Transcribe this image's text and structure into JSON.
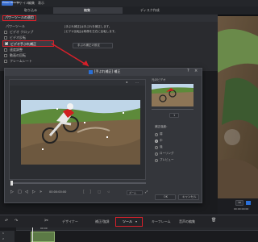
{
  "app": {
    "logo": "Power Director",
    "menu": [
      "ファイル",
      "編集",
      "表示",
      "再生",
      "ツール",
      "ヘルプ"
    ],
    "tabs": [
      {
        "label": "取り込み"
      },
      {
        "label": "編集"
      },
      {
        "label": "ディスク作成"
      }
    ],
    "active_tab": 1
  },
  "toolbar_row": {
    "left_label": "取り込み",
    "right_icons": [
      "grid-icon",
      "list-icon"
    ]
  },
  "tool_panel": {
    "title": "パワーツールの適用",
    "section_label": "パワーツール",
    "items": [
      {
        "label": "ビデオ クロップ",
        "checked": false
      },
      {
        "label": "ビデオ反転",
        "checked": false
      },
      {
        "label": "ビデオ手ぶれ補正",
        "checked": true
      },
      {
        "label": "速度調整",
        "checked": false
      },
      {
        "label": "動画の回転",
        "checked": false
      },
      {
        "label": "フレームレート",
        "checked": false
      }
    ],
    "description": [
      "[手ぶれ補正]は手ぶれを補正します。",
      "[ビデオ反転]は映像を左右に反転します。"
    ],
    "settings_button": "手ぶれ補正の設定"
  },
  "dialog": {
    "title": "[手ぶれ補正] 補正",
    "preview_label": "",
    "original_label": "元のビデオ",
    "strength_label": "補正強度：",
    "strength_value": "1",
    "options_label": "補正強度：",
    "options": [
      {
        "label": "弱",
        "selected": false
      },
      {
        "label": "中",
        "selected": true
      },
      {
        "label": "強",
        "selected": false
      },
      {
        "label": "ローリング",
        "selected": false
      },
      {
        "label": "プレビュー",
        "selected": false
      }
    ],
    "timecode": "00:00:00:00",
    "zoom": "ズーム",
    "ok": "OK",
    "cancel": "キャンセル"
  },
  "bottom_toolbar": {
    "items": [
      "デザイナー",
      "補正/強調",
      "ツール",
      "キーフレーム",
      "音声の編集"
    ],
    "highlighted": "ツール"
  },
  "timeline": {
    "track_labels": [
      "1",
      "2"
    ],
    "ruler_mark": "00:00"
  },
  "right_panel": {
    "playback_counter": "00:00:00:00",
    "buttons": [
      "3D"
    ]
  },
  "colors": {
    "highlight_red": "#d8202a",
    "accent_blue": "#2a6fd6",
    "panel_bg": "#2a2b2f",
    "dialog_bg": "#34363b"
  }
}
